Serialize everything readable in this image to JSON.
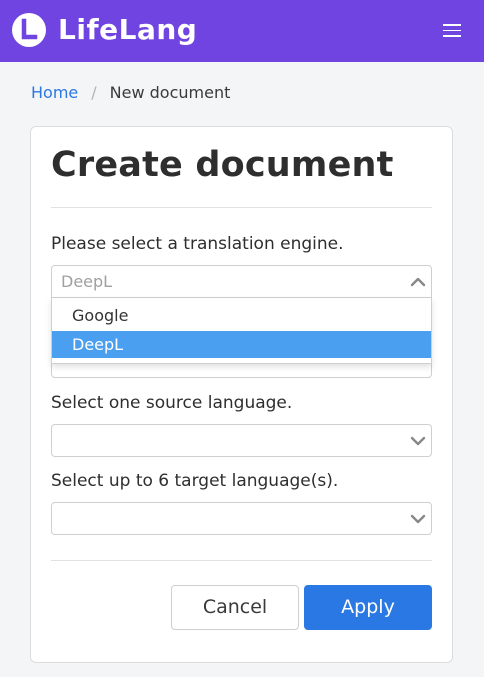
{
  "app": {
    "name": "LifeLang",
    "brand_color": "#6f44e0"
  },
  "breadcrumb": {
    "home": "Home",
    "separator": "/",
    "current": "New document"
  },
  "form": {
    "title": "Create document",
    "engine": {
      "label": "Please select a translation engine.",
      "value": "DeepL",
      "options": [
        "Google",
        "DeepL"
      ],
      "selected_option": "DeepL",
      "open": true
    },
    "source": {
      "label": "Select one source language.",
      "value": ""
    },
    "target": {
      "label": "Select up to 6 target language(s).",
      "value": ""
    },
    "cancel_label": "Cancel",
    "apply_label": "Apply"
  },
  "colors": {
    "accent": "#2a78e4",
    "highlight": "#4b9ff0"
  },
  "icons": {
    "logo": "lifelang-logo-icon",
    "menu": "hamburger-menu-icon",
    "chevron_up": "chevron-up-icon",
    "chevron_down": "chevron-down-icon"
  }
}
